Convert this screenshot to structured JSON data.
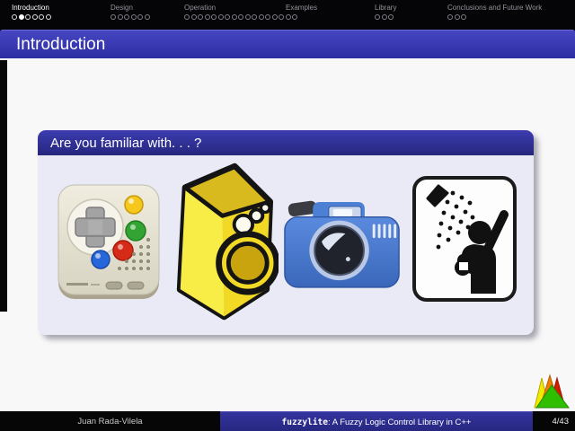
{
  "nav": {
    "sections": [
      {
        "label": "Introduction",
        "dots": 6,
        "active_dot": 1,
        "current": true
      },
      {
        "label": "Design",
        "dots": 6,
        "active_dot": -1,
        "current": false
      },
      {
        "label": "Operation",
        "dots": 17,
        "active_dot": -1,
        "current": false
      },
      {
        "label": "Examples",
        "dots": 0,
        "active_dot": -1,
        "current": false
      },
      {
        "label": "Library",
        "dots": 3,
        "active_dot": -1,
        "current": false
      },
      {
        "label": "Conclusions and Future Work",
        "dots": 3,
        "active_dot": -1,
        "current": false
      }
    ]
  },
  "header": {
    "title": "Introduction"
  },
  "block": {
    "title": "Are you familiar with. . . ?"
  },
  "icons": {
    "graphics": [
      "game-controller-icon",
      "washing-machine-icon",
      "camera-icon",
      "shower-sign-icon"
    ],
    "logo": "fuzzylite-logo"
  },
  "footer": {
    "author": "Juan Rada-Vilela",
    "brand": "fuzzylite",
    "title_rest": ": A Fuzzy Logic Control Library in C++",
    "page": "4/43"
  },
  "colors": {
    "title_bar_blue": "#3232b0",
    "block_header_blue": "#2b2b8e",
    "block_body_lavender": "#eaeaf6",
    "footer_blue": "#2b2b8c",
    "machine_yellow": "#f6e52e",
    "camera_blue": "#4a80d8",
    "logo_green": "#2fbf00",
    "logo_orange": "#ef7d00",
    "logo_red": "#d61a00",
    "logo_yellow": "#f2ea00"
  }
}
